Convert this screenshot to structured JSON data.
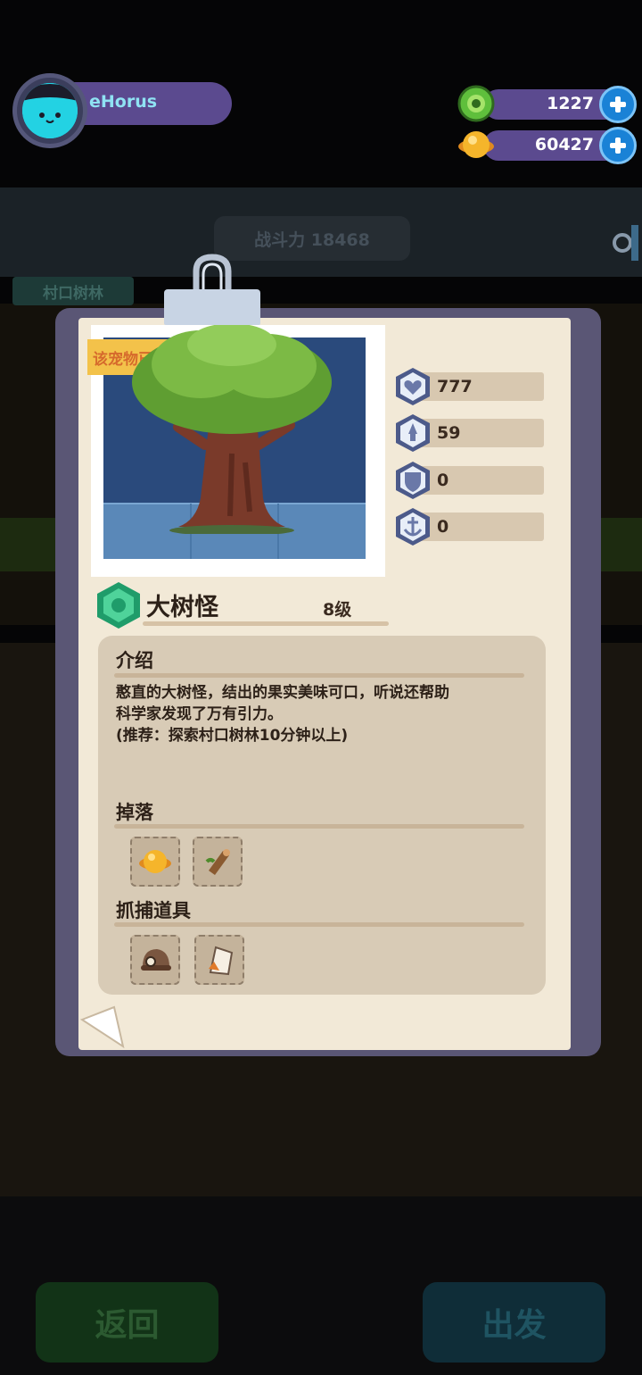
{
  "header": {
    "username": "eHorus",
    "currencies": [
      {
        "icon": "green-gem-icon",
        "value": "1227"
      },
      {
        "icon": "gold-coin-icon",
        "value": "60427"
      }
    ]
  },
  "background": {
    "combat_power": "战斗力 18468",
    "area_tag": "村口树林",
    "back_button": "返回",
    "go_button": "出发"
  },
  "card": {
    "badge": "该宠物已",
    "stats": [
      {
        "icon": "heart-icon",
        "value": "777"
      },
      {
        "icon": "attack-icon",
        "value": "59"
      },
      {
        "icon": "shield-icon",
        "value": "0"
      },
      {
        "icon": "anchor-icon",
        "value": "0"
      }
    ],
    "pet_name": "大树怪",
    "pet_level": "8级",
    "intro_title": "介绍",
    "intro_line1": "憨直的大树怪，结出的果实美味可口，听说还帮助",
    "intro_line2": "科学家发现了万有引力。",
    "intro_line3": "(推荐：探索村口树林10分钟以上)",
    "drops_title": "掉落",
    "drops": [
      "gold-coin-icon",
      "wood-log-icon"
    ],
    "capture_title": "抓捕道具",
    "capture_items": [
      "helmet-icon",
      "paper-bag-icon"
    ]
  },
  "colors": {
    "paper": "#f2e9d7",
    "frame": "#5a5675",
    "accent_purple": "#5b4a8f",
    "username": "#8fe3f3"
  }
}
